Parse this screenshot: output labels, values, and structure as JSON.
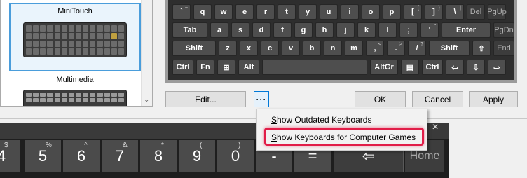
{
  "keyboard_list": {
    "items": [
      {
        "label": "MiniTouch",
        "selected": true
      },
      {
        "label": "Multimedia",
        "selected": false
      }
    ]
  },
  "preview": {
    "row1": [
      {
        "label": "`",
        "sub": "~"
      },
      {
        "label": "q"
      },
      {
        "label": "w"
      },
      {
        "label": "e"
      },
      {
        "label": "r"
      },
      {
        "label": "t"
      },
      {
        "label": "y"
      },
      {
        "label": "u"
      },
      {
        "label": "i"
      },
      {
        "label": "o"
      },
      {
        "label": "p"
      },
      {
        "label": "[",
        "sub": "{"
      },
      {
        "label": "]",
        "sub": "}"
      },
      {
        "label": "\\",
        "sub": "|"
      },
      {
        "label": "Del",
        "dark": true
      },
      {
        "label": "PgUp",
        "dark": true
      }
    ],
    "row2": [
      {
        "label": "Tab"
      },
      {
        "label": "a"
      },
      {
        "label": "s"
      },
      {
        "label": "d"
      },
      {
        "label": "f"
      },
      {
        "label": "g"
      },
      {
        "label": "h"
      },
      {
        "label": "j"
      },
      {
        "label": "k"
      },
      {
        "label": "l"
      },
      {
        "label": ";",
        "sub": ":"
      },
      {
        "label": "'",
        "sub": "\""
      },
      {
        "label": "Enter"
      },
      {
        "label": "PgDn",
        "dark": true
      }
    ],
    "row3": [
      {
        "label": "Shift"
      },
      {
        "label": "z"
      },
      {
        "label": "x"
      },
      {
        "label": "c"
      },
      {
        "label": "v"
      },
      {
        "label": "b"
      },
      {
        "label": "n"
      },
      {
        "label": "m"
      },
      {
        "label": ",",
        "sub": "<"
      },
      {
        "label": ".",
        "sub": ">"
      },
      {
        "label": "/",
        "sub": "?"
      },
      {
        "label": "Shift"
      },
      {
        "label": "⇧"
      },
      {
        "label": "End",
        "dark": true
      }
    ],
    "row4": [
      {
        "label": "Ctrl"
      },
      {
        "label": "Fn"
      },
      {
        "label": "⊞"
      },
      {
        "label": "Alt"
      },
      {
        "label": ""
      },
      {
        "label": "AltGr"
      },
      {
        "label": "▤"
      },
      {
        "label": "Ctrl"
      },
      {
        "label": "⇦"
      },
      {
        "label": "⇩"
      },
      {
        "label": "⇨"
      }
    ]
  },
  "buttons": {
    "edit": "Edit...",
    "more": "···",
    "ok": "OK",
    "cancel": "Cancel",
    "apply": "Apply"
  },
  "context_menu": {
    "items": [
      {
        "label": "Show Outdated Keyboards",
        "mnemonic": "S",
        "rest": "how Outdated Keyboards"
      },
      {
        "label": "Show Keyboards for Computer Games",
        "mnemonic": "S",
        "rest": "how Keyboards for Computer Games",
        "highlighted": true
      }
    ]
  },
  "big_keyboard": {
    "close": "×",
    "keys": [
      {
        "label": "4",
        "sub": "$"
      },
      {
        "label": "5",
        "sub": "%"
      },
      {
        "label": "6",
        "sub": "^"
      },
      {
        "label": "7",
        "sub": "&"
      },
      {
        "label": "8",
        "sub": "*"
      },
      {
        "label": "9",
        "sub": "("
      },
      {
        "label": "0",
        "sub": ")"
      },
      {
        "label": "-",
        "sub": "_"
      },
      {
        "label": "=",
        "sub": "+"
      }
    ],
    "backspace": "⇦",
    "home": "Home"
  },
  "colors": {
    "selection_border": "#4a9ddb",
    "highlight_outline": "#e11d48",
    "preview_bg": "#2e2e2e",
    "key_bg": "#4e4e4e"
  }
}
